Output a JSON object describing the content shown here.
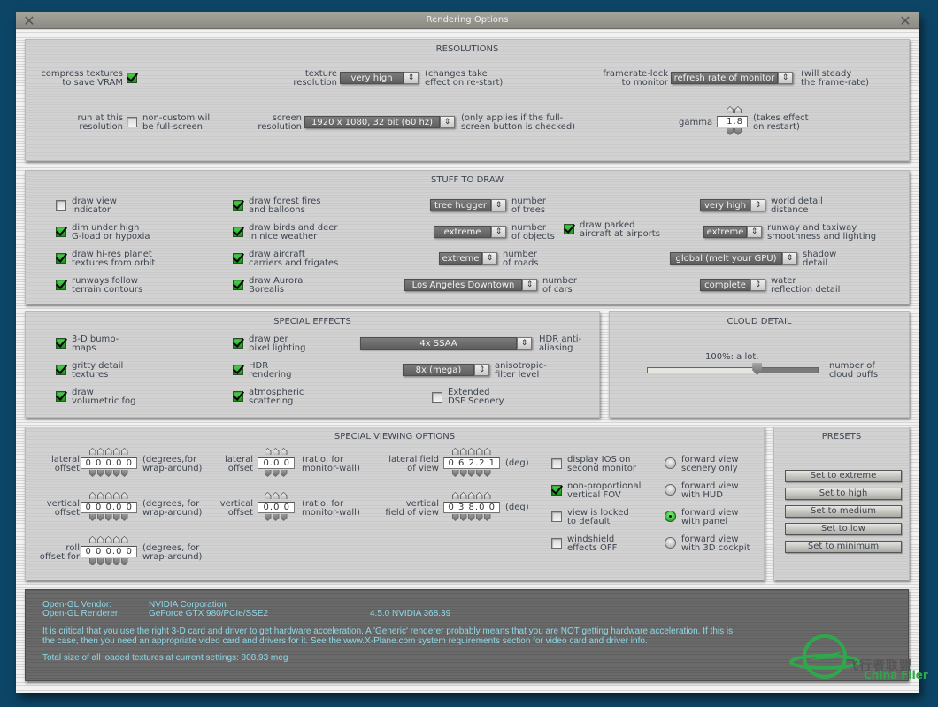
{
  "window": {
    "title": "Rendering Options",
    "close_icon": "close-icon"
  },
  "resolutions": {
    "title": "RESOLUTIONS",
    "compress_textures": {
      "label": [
        "compress textures",
        "to save VRAM"
      ],
      "checked": true
    },
    "texture_resolution": {
      "label": [
        "texture",
        "resolution"
      ],
      "value": "very high",
      "note": [
        "(changes take",
        "effect on re-start)"
      ]
    },
    "framerate_lock": {
      "label": [
        "framerate-lock",
        "to monitor"
      ],
      "value": "refresh rate of monitor",
      "note": [
        "(will steady",
        "the frame-rate)"
      ]
    },
    "run_at_resolution": {
      "label": [
        "run at this",
        "resolution"
      ],
      "checked": false,
      "note": [
        "non-custom will",
        "be full-screen"
      ]
    },
    "screen_resolution": {
      "label": [
        "screen",
        "resolution"
      ],
      "value": "1920 x 1080, 32 bit (60 hz)",
      "note": [
        "(only applies if the full-",
        "screen button is checked)"
      ]
    },
    "gamma": {
      "label": "gamma",
      "value": "1.8",
      "note": [
        "(takes effect",
        "on restart)"
      ]
    }
  },
  "stuff_to_draw": {
    "title": "STUFF TO DRAW",
    "checks_col1": [
      {
        "label": [
          "draw view",
          "indicator"
        ],
        "checked": false
      },
      {
        "label": [
          "dim under high",
          "G-load or hypoxia"
        ],
        "checked": true
      },
      {
        "label": [
          "draw hi-res planet",
          "textures from orbit"
        ],
        "checked": true
      },
      {
        "label": [
          "runways follow",
          "terrain contours"
        ],
        "checked": true
      }
    ],
    "checks_col2": [
      {
        "label": [
          "draw forest fires",
          "and balloons"
        ],
        "checked": true
      },
      {
        "label": [
          "draw birds and deer",
          "in nice weather"
        ],
        "checked": true
      },
      {
        "label": [
          "draw aircraft",
          "carriers and frigates"
        ],
        "checked": true
      },
      {
        "label": [
          "draw Aurora",
          "Borealis"
        ],
        "checked": true
      }
    ],
    "selects_mid": [
      {
        "value": "tree hugger",
        "label": [
          "number",
          "of trees"
        ]
      },
      {
        "value": "extreme",
        "label": [
          "number",
          "of objects"
        ]
      },
      {
        "value": "extreme",
        "label": [
          "number",
          "of roads"
        ]
      },
      {
        "value": "Los Angeles Downtown",
        "label": [
          "number",
          "of cars"
        ]
      }
    ],
    "parked_aircraft": {
      "label": [
        "draw parked",
        "aircraft at airports"
      ],
      "checked": true
    },
    "selects_right": [
      {
        "value": "very high",
        "label": [
          "world detail",
          "distance"
        ]
      },
      {
        "value": "extreme",
        "label": [
          "runway and taxiway",
          "smoothness and lighting"
        ]
      },
      {
        "value": "global (melt your GPU)",
        "label": [
          "shadow",
          "detail"
        ]
      },
      {
        "value": "complete",
        "label": [
          "water",
          "reflection detail"
        ]
      }
    ]
  },
  "special_effects": {
    "title": "SPECIAL EFFECTS",
    "checks_col1": [
      {
        "label": [
          "3-D bump-",
          "maps"
        ],
        "checked": true
      },
      {
        "label": [
          "gritty detail",
          "textures"
        ],
        "checked": true
      },
      {
        "label": [
          "draw",
          "volumetric fog"
        ],
        "checked": true
      }
    ],
    "checks_col2": [
      {
        "label": [
          "draw per",
          "pixel lighting"
        ],
        "checked": true
      },
      {
        "label": [
          "HDR",
          "rendering"
        ],
        "checked": true
      },
      {
        "label": [
          "atmospheric",
          "scattering"
        ],
        "checked": true
      }
    ],
    "hdr_aa": {
      "value": "4x SSAA",
      "label": [
        "HDR anti-",
        "aliasing"
      ]
    },
    "aniso": {
      "value": "8x (mega)",
      "label": [
        "anisotropic-",
        "filter level"
      ]
    },
    "extended_dsf": {
      "label": [
        "Extended",
        "DSF Scenery"
      ],
      "checked": false
    }
  },
  "cloud_detail": {
    "title": "CLOUD DETAIL",
    "readout": "100%: a lot.",
    "slider_fraction": 0.64,
    "label": [
      "number of",
      "cloud puffs"
    ]
  },
  "special_viewing": {
    "title": "SPECIAL VIEWING OPTIONS",
    "deg_fields": [
      {
        "label": [
          "lateral",
          "offset"
        ],
        "value": "0 0 0.0 0",
        "note": [
          "(degrees,for",
          "wrap-around)"
        ]
      },
      {
        "label": [
          "vertical",
          "offset"
        ],
        "value": "0 0 0.0 0",
        "note": [
          "(degrees, for",
          "wrap-around)"
        ]
      },
      {
        "label": [
          "roll",
          "offset for"
        ],
        "value": "0 0 0.0 0",
        "note": [
          "(degrees, for",
          "wrap-around)"
        ]
      }
    ],
    "ratio_fields": [
      {
        "label": [
          "lateral",
          "offset"
        ],
        "value": "0.0 0",
        "note": [
          "(ratio, for",
          "monitor-wall)"
        ]
      },
      {
        "label": [
          "vertical",
          "offset"
        ],
        "value": "0.0 0",
        "note": [
          "(ratio, for",
          "monitor-wall)"
        ]
      }
    ],
    "fov_fields": [
      {
        "label": [
          "lateral field",
          "of view"
        ],
        "value": "0 6 2.2 1",
        "note": "(deg)"
      },
      {
        "label": [
          "vertical",
          "field of view"
        ],
        "value": "0 3 8.0 0",
        "note": "(deg)"
      }
    ],
    "checks": [
      {
        "label": [
          "display IOS on",
          "second monitor"
        ],
        "checked": false
      },
      {
        "label": [
          "non-proportional",
          "vertical FOV"
        ],
        "checked": true
      },
      {
        "label": [
          "view is locked",
          "to default"
        ],
        "checked": false
      },
      {
        "label": [
          "windshield",
          "effects OFF"
        ],
        "checked": false
      }
    ],
    "radios": [
      {
        "label": [
          "forward view",
          "scenery only"
        ],
        "selected": false
      },
      {
        "label": [
          "forward view",
          "with HUD"
        ],
        "selected": false
      },
      {
        "label": [
          "forward view",
          "with panel"
        ],
        "selected": true
      },
      {
        "label": [
          "forward view",
          "with 3D cockpit"
        ],
        "selected": false
      }
    ]
  },
  "presets": {
    "title": "PRESETS",
    "buttons": [
      "Set to extreme",
      "Set to high",
      "Set to medium",
      "Set to low",
      "Set to minimum"
    ]
  },
  "info": {
    "vendor_label": "Open-GL Vendor:",
    "vendor": "NVIDIA Corporation",
    "renderer_label": "Open-GL Renderer:",
    "renderer": "GeForce GTX 980/PCIe/SSE2",
    "version": "4.5.0 NVIDIA 368.39",
    "warning_line1": "It is critical that you use the right 3-D card and driver to get hardware acceleration. A 'Generic' renderer probably means that you are NOT getting hardware acceleration. If this is",
    "warning_line2": "the case, then you need an appropriate video card and drivers for it. See the www.X-Plane.com system requirements section for video card and driver info.",
    "texture_size": "Total size of all loaded textures at current settings: 808.93 meg"
  },
  "watermark": {
    "cn": "飞行者联盟",
    "en": "China Flier",
    "color": "#2ea84a"
  }
}
